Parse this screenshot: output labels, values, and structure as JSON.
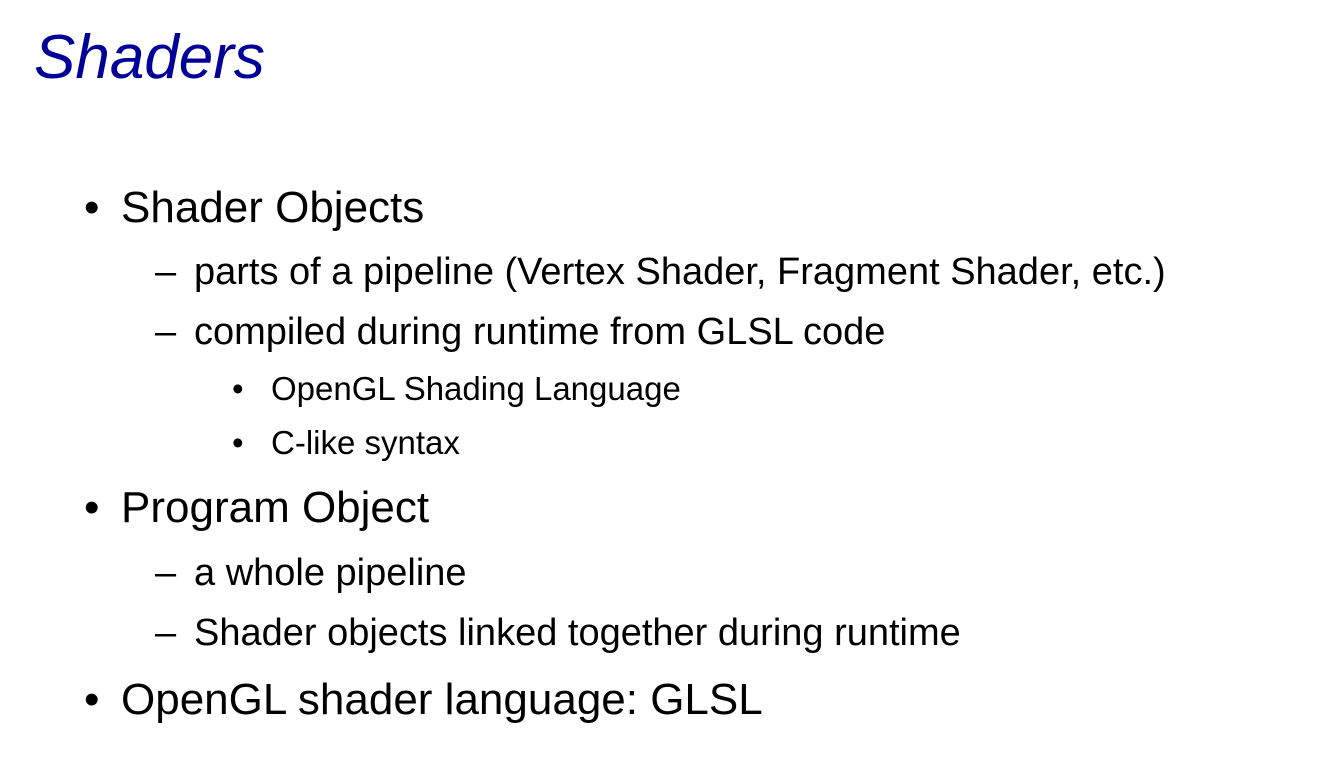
{
  "slide": {
    "title": "Shaders",
    "bullets": [
      {
        "level": 1,
        "marker": "•",
        "text": "Shader Objects"
      },
      {
        "level": 2,
        "marker": "–",
        "text": "parts of a pipeline (Vertex Shader, Fragment Shader, etc.)"
      },
      {
        "level": 2,
        "marker": "–",
        "text": "compiled during runtime from GLSL code"
      },
      {
        "level": 3,
        "marker": "•",
        "text": "OpenGL Shading Language"
      },
      {
        "level": 3,
        "marker": "•",
        "text": "C-like syntax"
      },
      {
        "level": 1,
        "marker": "•",
        "text": "Program Object"
      },
      {
        "level": 2,
        "marker": "–",
        "text": "a whole pipeline"
      },
      {
        "level": 2,
        "marker": "–",
        "text": "Shader objects linked together during runtime"
      },
      {
        "level": 1,
        "marker": "•",
        "text": "OpenGL shader language: GLSL"
      }
    ]
  },
  "colors": {
    "title": "#000099",
    "text": "#000000",
    "background": "#ffffff"
  }
}
